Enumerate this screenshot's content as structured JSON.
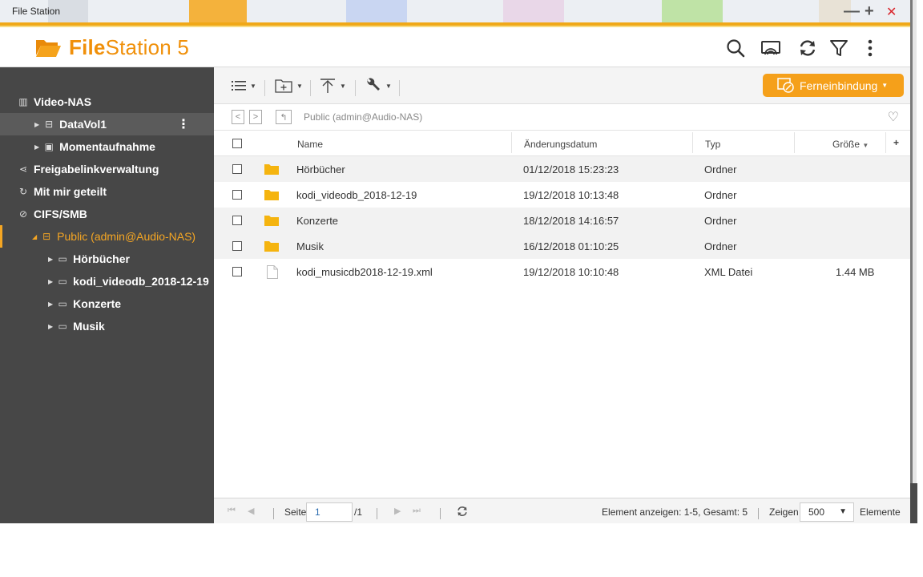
{
  "window": {
    "title": "File Station",
    "minimize_glyph": "—",
    "maximize_glyph": "+",
    "close_glyph": "✕"
  },
  "header": {
    "logo_bold": "File",
    "logo_rest": "Station 5",
    "icons": [
      "search-icon",
      "cast-icon",
      "refresh-icon",
      "filter-icon",
      "more-icon"
    ],
    "accent_color": "#f0900a"
  },
  "sidebar": {
    "nas_name": "Video-NAS",
    "items": [
      {
        "label": "DataVol1",
        "icon": "drive-icon"
      },
      {
        "label": "Momentaufnahme",
        "icon": "snapshot-icon"
      },
      {
        "label": "Freigabelinkverwaltung",
        "icon": "share-icon"
      },
      {
        "label": "Mit mir geteilt",
        "icon": "shared-with-me-icon"
      },
      {
        "label": "CIFS/SMB",
        "icon": "smb-icon"
      },
      {
        "label": "Public (admin@Audio-NAS)",
        "icon": "network-drive-icon"
      },
      {
        "label": "Hörbücher",
        "icon": "folder-icon"
      },
      {
        "label": "kodi_videodb_2018-12-19",
        "icon": "folder-icon"
      },
      {
        "label": "Konzerte",
        "icon": "folder-icon"
      },
      {
        "label": "Musik",
        "icon": "folder-icon"
      }
    ],
    "active_color": "#f5a623"
  },
  "toolbar": {
    "remote_button": "Ferneinbindung"
  },
  "pathbar": {
    "path": "Public (admin@Audio-NAS)"
  },
  "table": {
    "columns": {
      "name": "Name",
      "date": "Änderungsdatum",
      "type": "Typ",
      "size": "Größe"
    },
    "rows": [
      {
        "name": "Hörbücher",
        "date": "01/12/2018 15:23:23",
        "type": "Ordner",
        "size": "",
        "kind": "folder"
      },
      {
        "name": "kodi_videodb_2018-12-19",
        "date": "19/12/2018 10:13:48",
        "type": "Ordner",
        "size": "",
        "kind": "folder"
      },
      {
        "name": "Konzerte",
        "date": "18/12/2018 14:16:57",
        "type": "Ordner",
        "size": "",
        "kind": "folder"
      },
      {
        "name": "Musik",
        "date": "16/12/2018 01:10:25",
        "type": "Ordner",
        "size": "",
        "kind": "folder"
      },
      {
        "name": "kodi_musicdb2018-12-19.xml",
        "date": "19/12/2018 10:10:48",
        "type": "XML Datei",
        "size": "1.44 MB",
        "kind": "file"
      }
    ]
  },
  "footer": {
    "page_label": "Seite",
    "page_value": "1",
    "page_total": "/1",
    "summary": "Element anzeigen: 1-5, Gesamt: 5",
    "show_label": "Zeigen",
    "show_value": "500",
    "elements_label": "Elemente"
  }
}
